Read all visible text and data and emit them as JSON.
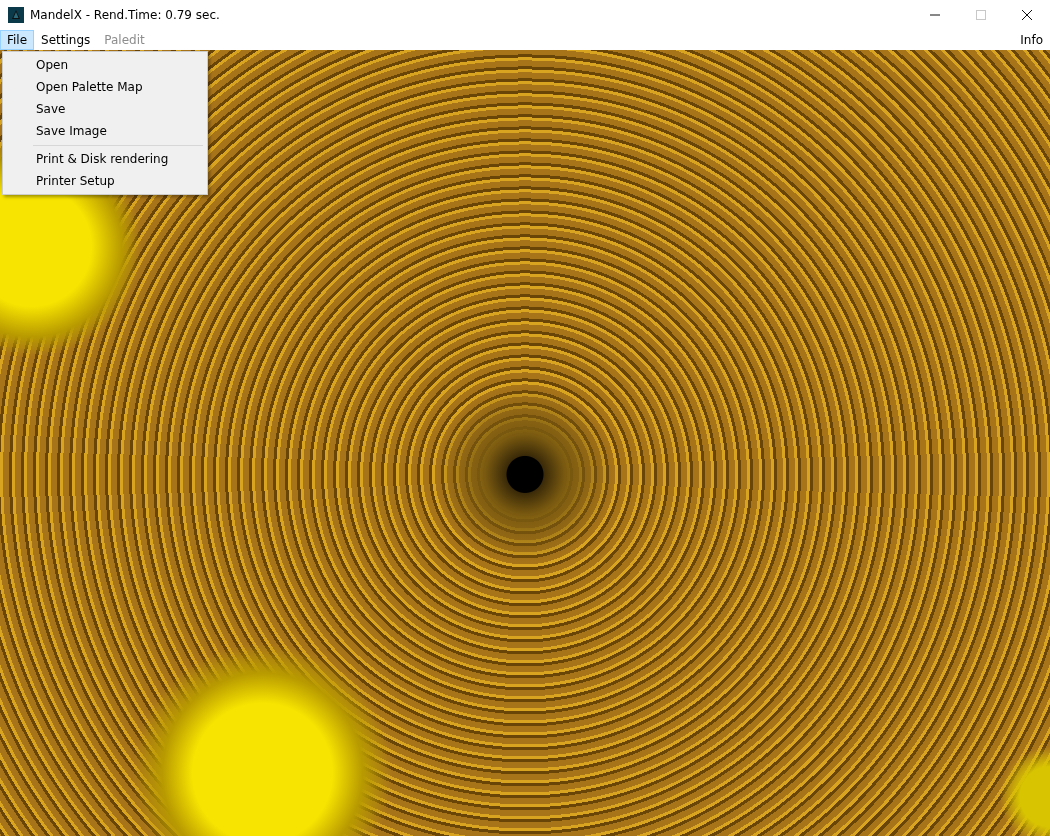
{
  "window": {
    "title": "MandelX - Rend.Time:  0.79 sec.",
    "controls": [
      {
        "kind": "minimize",
        "disabled": false
      },
      {
        "kind": "maximize",
        "disabled": true
      },
      {
        "kind": "close",
        "disabled": false
      }
    ]
  },
  "menu_bar": {
    "items": [
      {
        "label": "File",
        "selected": true,
        "disabled": false
      },
      {
        "label": "Settings",
        "selected": false,
        "disabled": false
      },
      {
        "label": "Paledit",
        "selected": false,
        "disabled": true
      }
    ],
    "right_item": {
      "label": "Info"
    }
  },
  "file_menu": {
    "items": [
      {
        "label": "Open",
        "separator_before": false
      },
      {
        "label": "Open Palette Map",
        "separator_before": false
      },
      {
        "label": "Save",
        "separator_before": false
      },
      {
        "label": "Save Image",
        "separator_before": false
      },
      {
        "label": "Print & Disk rendering",
        "separator_before": true
      },
      {
        "label": "Printer Setup",
        "separator_before": false
      }
    ]
  }
}
